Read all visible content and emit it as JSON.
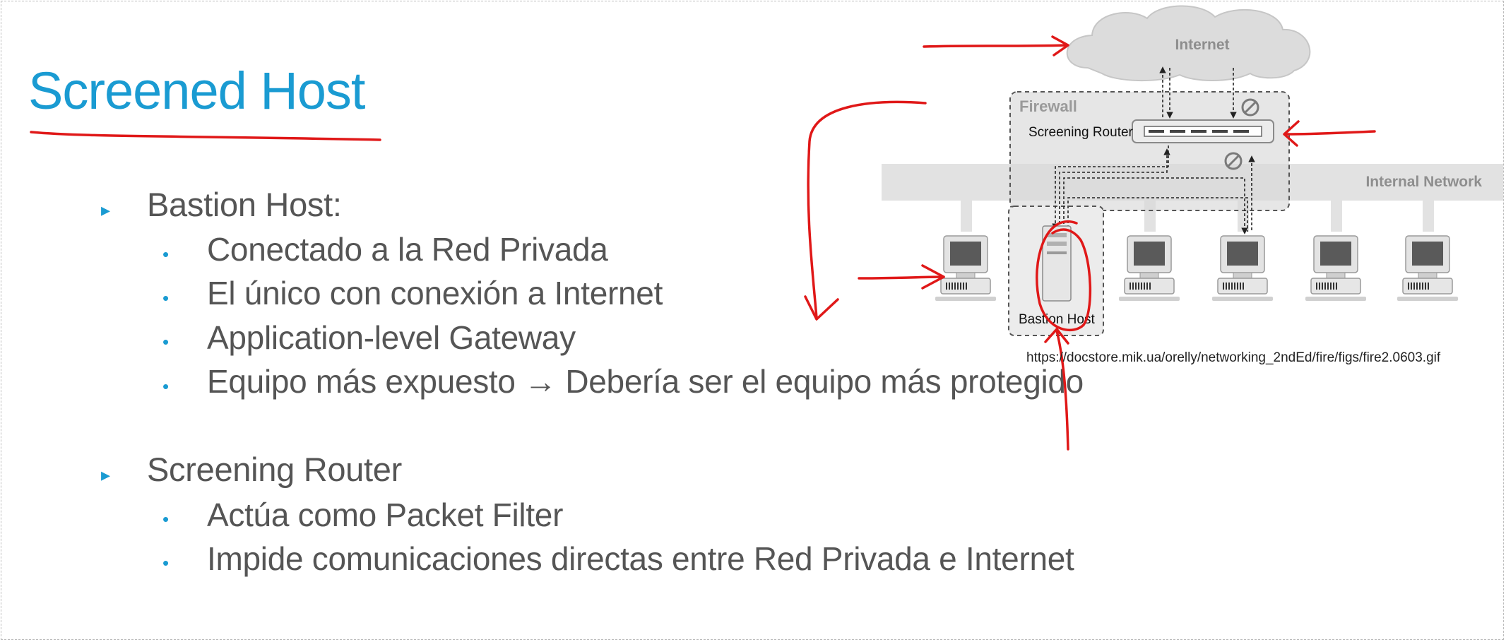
{
  "slide": {
    "title": "Screened Host",
    "sections": [
      {
        "heading": "Bastion Host:",
        "items": [
          "Conectado a la Red Privada",
          "El único con conexión a Internet",
          "Application-level Gateway",
          "Equipo más expuesto → Debería ser el equipo más protegido"
        ]
      },
      {
        "heading": "Screening Router",
        "items": [
          "Actúa como Packet Filter",
          "Impide comunicaciones directas entre Red Privada e Internet"
        ]
      }
    ],
    "bullet_markers": {
      "level1": "▸",
      "level2": "•"
    }
  },
  "diagram": {
    "internet_label": "Internet",
    "firewall_label": "Firewall",
    "router_label": "Screening Router",
    "network_label": "Internal Network",
    "bastion_label": "Bastion Host",
    "caption": "https://docstore.mik.ua/orelly/networking_2ndEd/fire/figs/fire2.0603.gif"
  },
  "colors": {
    "title": "#1a9bd2",
    "body_text": "#555555",
    "marker": "#1a9bd2",
    "annotation": "#e01818",
    "diagram_gray": "#cfcfcf"
  }
}
